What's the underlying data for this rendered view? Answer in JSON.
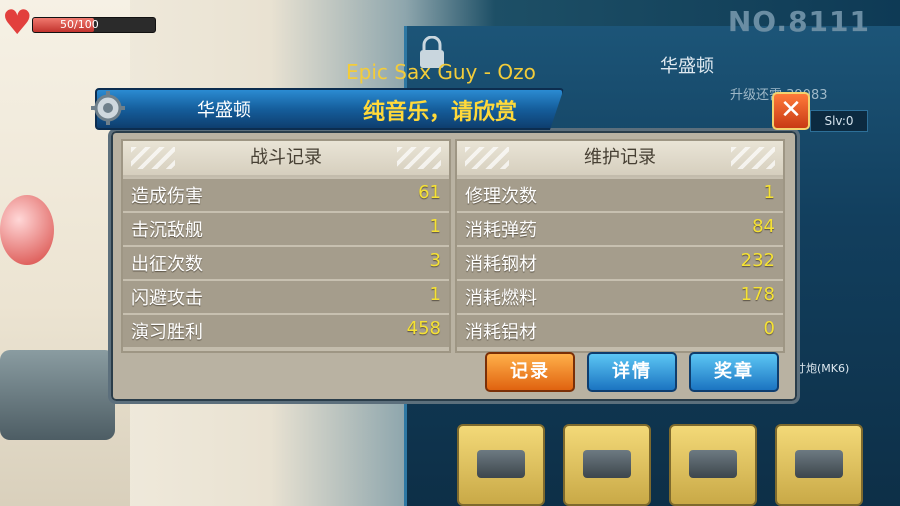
{
  "hud": {
    "hp_text": "50/100",
    "hp_fraction": 0.5,
    "ship_number": "NO.8111"
  },
  "background_card": {
    "ship_name": "华盛顿",
    "upgrade_text": "升级还需 39083",
    "slv": "Slv:0",
    "weapon_label": "寸炮(MK6)"
  },
  "overlay": {
    "track": "Epic Sax Guy - Ozo"
  },
  "dialog": {
    "ship_name": "华盛顿",
    "subtitle": "纯音乐，请欣赏",
    "close_label": "✕",
    "battle": {
      "header": "战斗记录",
      "rows": [
        {
          "label": "造成伤害",
          "value": "61"
        },
        {
          "label": "击沉敌舰",
          "value": "1"
        },
        {
          "label": "出征次数",
          "value": "3"
        },
        {
          "label": "闪避攻击",
          "value": "1"
        },
        {
          "label": "演习胜利",
          "value": "458"
        }
      ]
    },
    "maintenance": {
      "header": "维护记录",
      "rows": [
        {
          "label": "修理次数",
          "value": "1"
        },
        {
          "label": "消耗弹药",
          "value": "84"
        },
        {
          "label": "消耗钢材",
          "value": "232"
        },
        {
          "label": "消耗燃料",
          "value": "178"
        },
        {
          "label": "消耗铝材",
          "value": "0"
        }
      ]
    },
    "buttons": {
      "record": "记录",
      "detail": "详情",
      "medal": "奖章"
    }
  }
}
